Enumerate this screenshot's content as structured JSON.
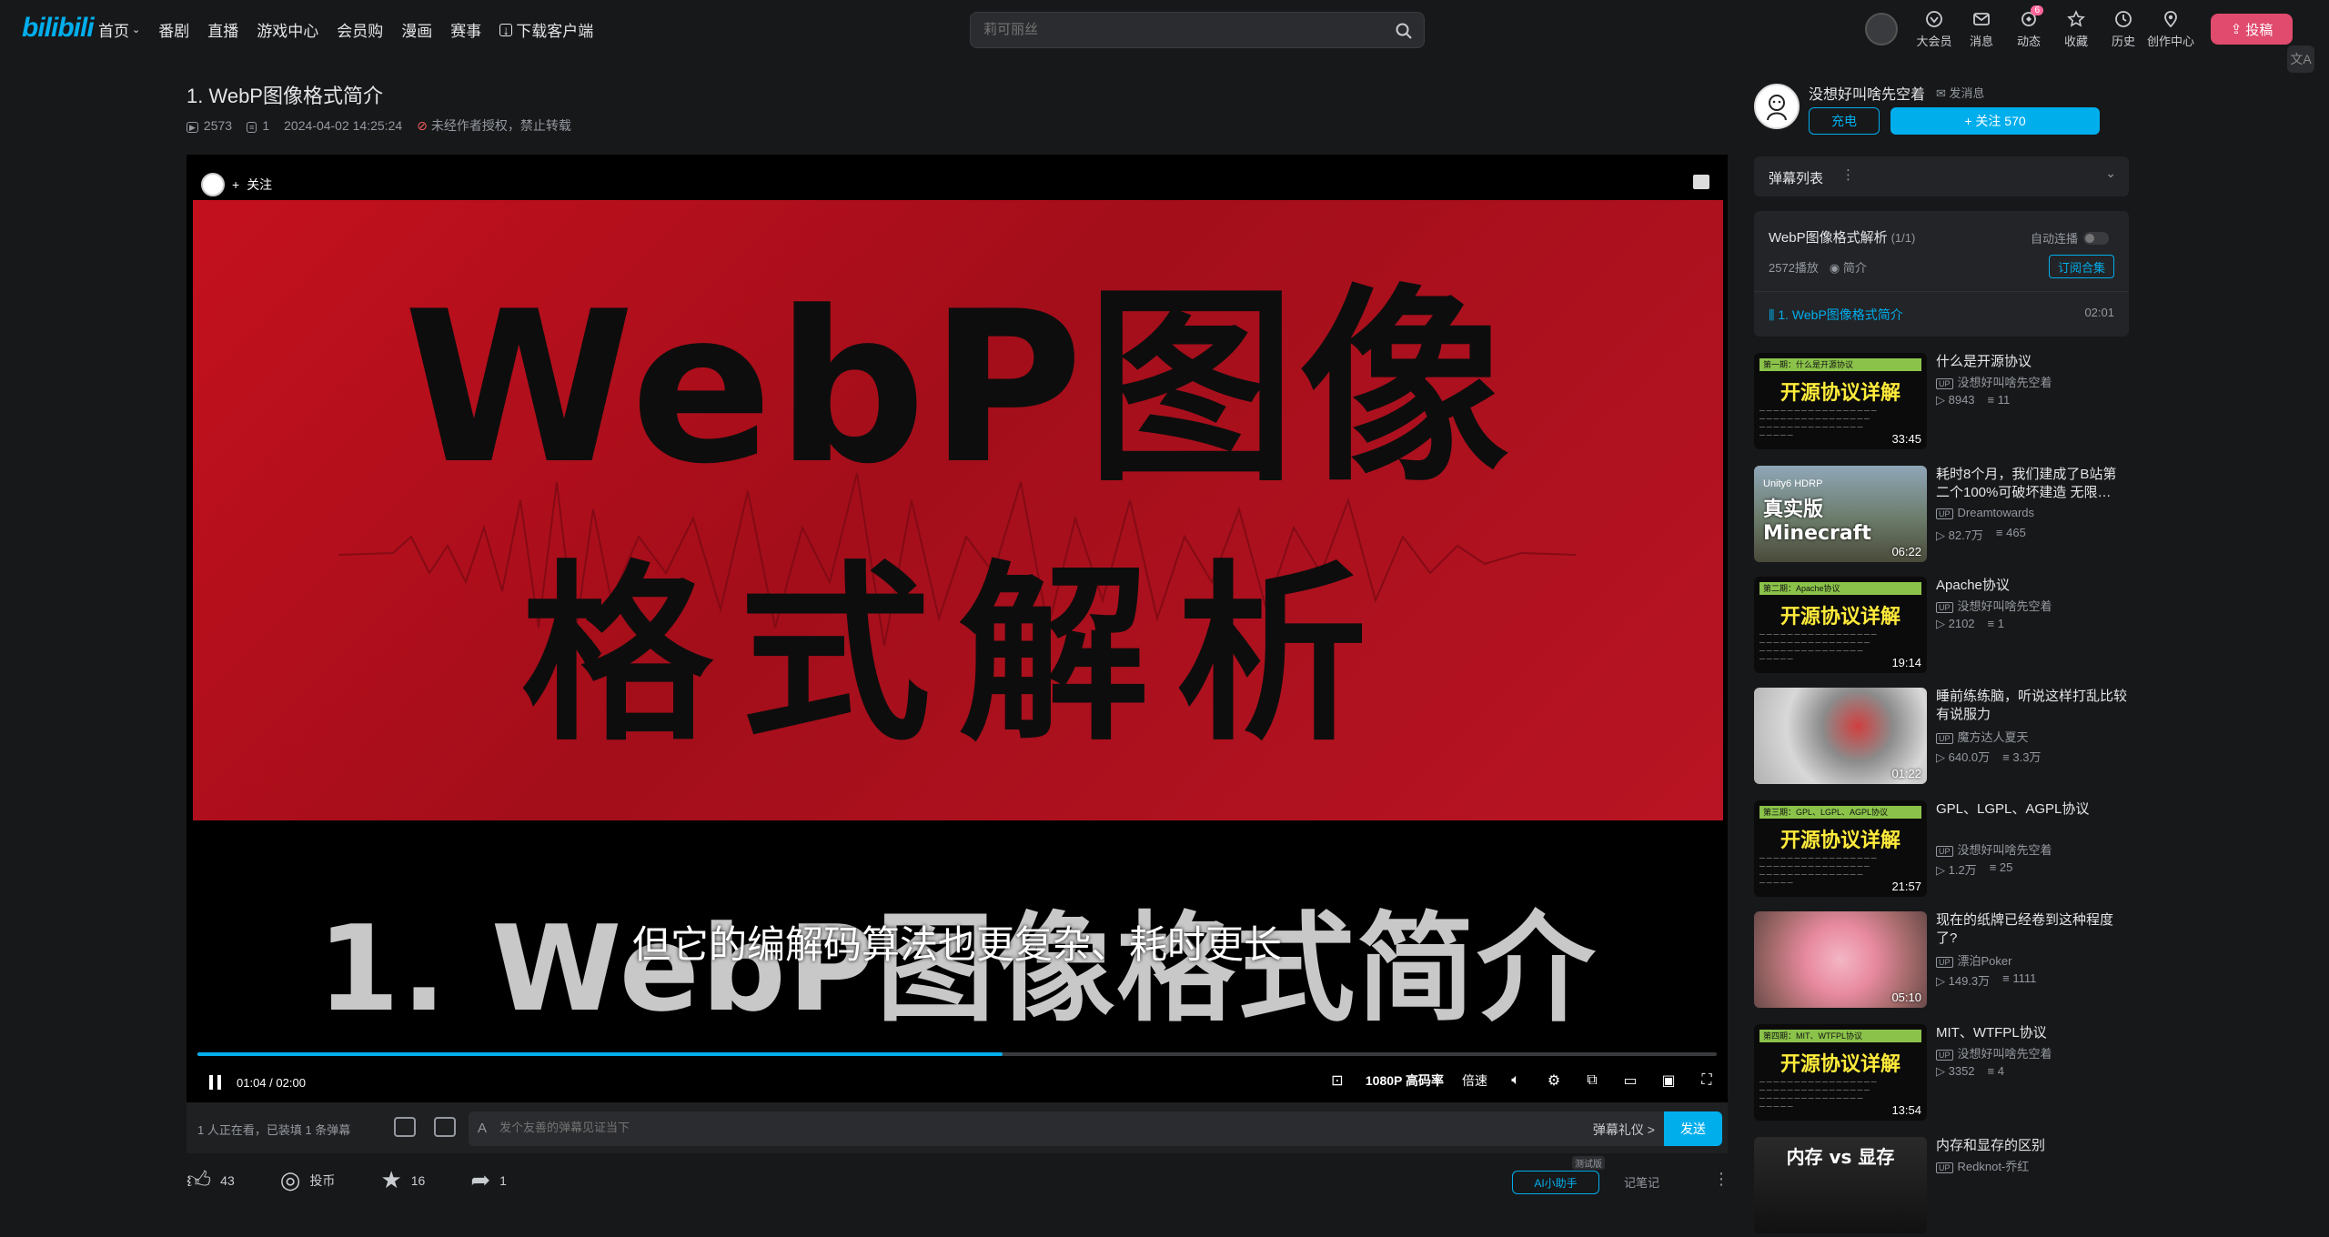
{
  "nav": {
    "logo": "bilibili",
    "items": [
      "首页",
      "番剧",
      "直播",
      "游戏中心",
      "会员购",
      "漫画",
      "赛事",
      "下载客户端"
    ],
    "search_placeholder": "莉可丽丝",
    "right": [
      {
        "label": "大会员",
        "icon": "vip-icon"
      },
      {
        "label": "消息",
        "icon": "message-icon"
      },
      {
        "label": "动态",
        "icon": "dynamic-icon",
        "badge": "6"
      },
      {
        "label": "收藏",
        "icon": "favorite-icon"
      },
      {
        "label": "历史",
        "icon": "history-icon"
      },
      {
        "label": "创作中心",
        "icon": "creator-icon"
      }
    ],
    "upload": "投稿",
    "translate": "文A"
  },
  "video": {
    "title": "1. WebP图像格式简介",
    "views": "2573",
    "danmaku": "1",
    "date": "2024-04-02 14:25:24",
    "copyright": "未经作者授权，禁止转载"
  },
  "player": {
    "follow": "关注",
    "frame_line1": "WebP图像",
    "frame_line2": "格式解析",
    "big_subtitle": "1. WebP图像格式简介",
    "caption": "但它的编解码算法也更复杂、耗时更长",
    "time_current": "01:04",
    "time_sep": "/",
    "time_total": "02:00",
    "progress": 0.53,
    "quality": "1080P 高码率",
    "speed": "倍速"
  },
  "danmaku_bar": {
    "watching": "1 人正在看，已装填 1 条弹幕",
    "placeholder": "发个友善的弹幕见证当下",
    "etiquette": "弹幕礼仪 >",
    "send": "发送"
  },
  "actions": {
    "like": "43",
    "coin": "投币",
    "fav": "16",
    "share": "1",
    "ai_summary": "AI小助手",
    "ai_tag": "测试版",
    "report": "记笔记"
  },
  "uploader": {
    "name": "没想好叫啥先空着",
    "message": "发消息",
    "charge": "充电",
    "follow": "+ 关注 570"
  },
  "danmaku_list": {
    "label": "弹幕列表"
  },
  "collection": {
    "title": "WebP图像格式解析",
    "count": "(1/1)",
    "autoplay": "自动连播",
    "plays": "2572播放",
    "intro": "简介",
    "subscribe": "订阅合集",
    "item": "1. WebP图像格式简介",
    "item_duration": "02:01"
  },
  "recommendations": [
    {
      "title": "什么是开源协议",
      "up": "没想好叫啥先空着",
      "views": "8943",
      "danmaku": "11",
      "duration": "33:45",
      "thumb": "green",
      "thumb_title": "开源协议详解",
      "thumb_bar": "第一期：什么是开源协议"
    },
    {
      "title": "耗时8个月，我们建成了B站第二个100%可破坏建造 无限…",
      "up": "Dreamtowards",
      "views": "82.7万",
      "danmaku": "465",
      "duration": "06:22",
      "thumb": "minecraft",
      "thumb_title": "真实版 Minecraft",
      "thumb_bar": "Unity6 HDRP"
    },
    {
      "title": "Apache协议",
      "up": "没想好叫啥先空着",
      "views": "2102",
      "danmaku": "1",
      "duration": "19:14",
      "thumb": "green",
      "thumb_title": "开源协议详解",
      "thumb_bar": "第二期：Apache协议"
    },
    {
      "title": "睡前练练脑，听说这样打乱比较有说服力",
      "up": "魔方达人夏天",
      "views": "640.0万",
      "danmaku": "3.3万",
      "duration": "01:22",
      "thumb": "cube",
      "thumb_title": "",
      "thumb_bar": ""
    },
    {
      "title": "GPL、LGPL、AGPL协议",
      "up": "没想好叫啥先空着",
      "views": "1.2万",
      "danmaku": "25",
      "duration": "21:57",
      "thumb": "green",
      "thumb_title": "开源协议详解",
      "thumb_bar": "第三期：GPL、LGPL、AGPL协议"
    },
    {
      "title": "现在的纸牌已经卷到这种程度了?",
      "up": "漂泊Poker",
      "views": "149.3万",
      "danmaku": "1111",
      "duration": "05:10",
      "thumb": "cards",
      "thumb_title": "",
      "thumb_bar": ""
    },
    {
      "title": "MIT、WTFPL协议",
      "up": "没想好叫啥先空着",
      "views": "3352",
      "danmaku": "4",
      "duration": "13:54",
      "thumb": "green",
      "thumb_title": "开源协议详解",
      "thumb_bar": "第四期：MIT、WTFPL协议"
    },
    {
      "title": "内存和显存的区别",
      "up": "Redknot-乔红",
      "views": "",
      "danmaku": "",
      "duration": "",
      "thumb": "memory",
      "thumb_title": "内存 vs 显存",
      "thumb_bar": ""
    }
  ],
  "colors": {
    "accent": "#00aeec",
    "pink": "#ff6699",
    "frame_red": "#b4111f"
  }
}
